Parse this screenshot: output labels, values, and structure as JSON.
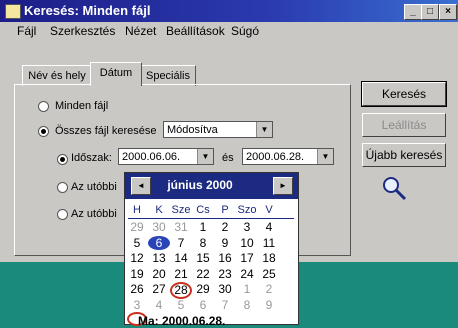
{
  "window": {
    "title": "Keresés: Minden fájl",
    "controls": {
      "minimize": "_",
      "maximize": "□",
      "close": "×"
    }
  },
  "menu": [
    {
      "label": "Fájl"
    },
    {
      "label": "Szerkesztés"
    },
    {
      "label": "Nézet"
    },
    {
      "label": "Beállítások"
    },
    {
      "label": "Súgó"
    }
  ],
  "tabs": [
    {
      "label": "Név és hely"
    },
    {
      "label": "Dátum"
    },
    {
      "label": "Speciális"
    }
  ],
  "options": {
    "all_files": "Minden fájl",
    "search_all": "Összes fájl keresése",
    "search_all_value": "Módosítva",
    "period": "Időszak:",
    "from_date": "2000.06.06.",
    "and": "és",
    "to_date": "2000.06.28.",
    "previous_1": "Az utóbbi",
    "previous_2": "Az utóbbi"
  },
  "buttons": {
    "search": "Keresés",
    "stop": "Leállítás",
    "new_search": "Újabb keresés"
  },
  "calendar": {
    "month": "június 2000",
    "prev": "◄",
    "next": "►",
    "weekdays": [
      "H",
      "K",
      "Sze",
      "Cs",
      "P",
      "Szo",
      "V"
    ],
    "weeks": [
      [
        "29",
        "30",
        "31",
        "1",
        "2",
        "3",
        "4"
      ],
      [
        "5",
        "6",
        "7",
        "8",
        "9",
        "10",
        "11"
      ],
      [
        "12",
        "13",
        "14",
        "15",
        "16",
        "17",
        "18"
      ],
      [
        "19",
        "20",
        "21",
        "22",
        "23",
        "24",
        "25"
      ],
      [
        "26",
        "27",
        "28",
        "29",
        "30",
        "1",
        "2"
      ],
      [
        "3",
        "4",
        "5",
        "6",
        "7",
        "8",
        "9"
      ]
    ],
    "footer": "Ma: 2000.06.28."
  }
}
